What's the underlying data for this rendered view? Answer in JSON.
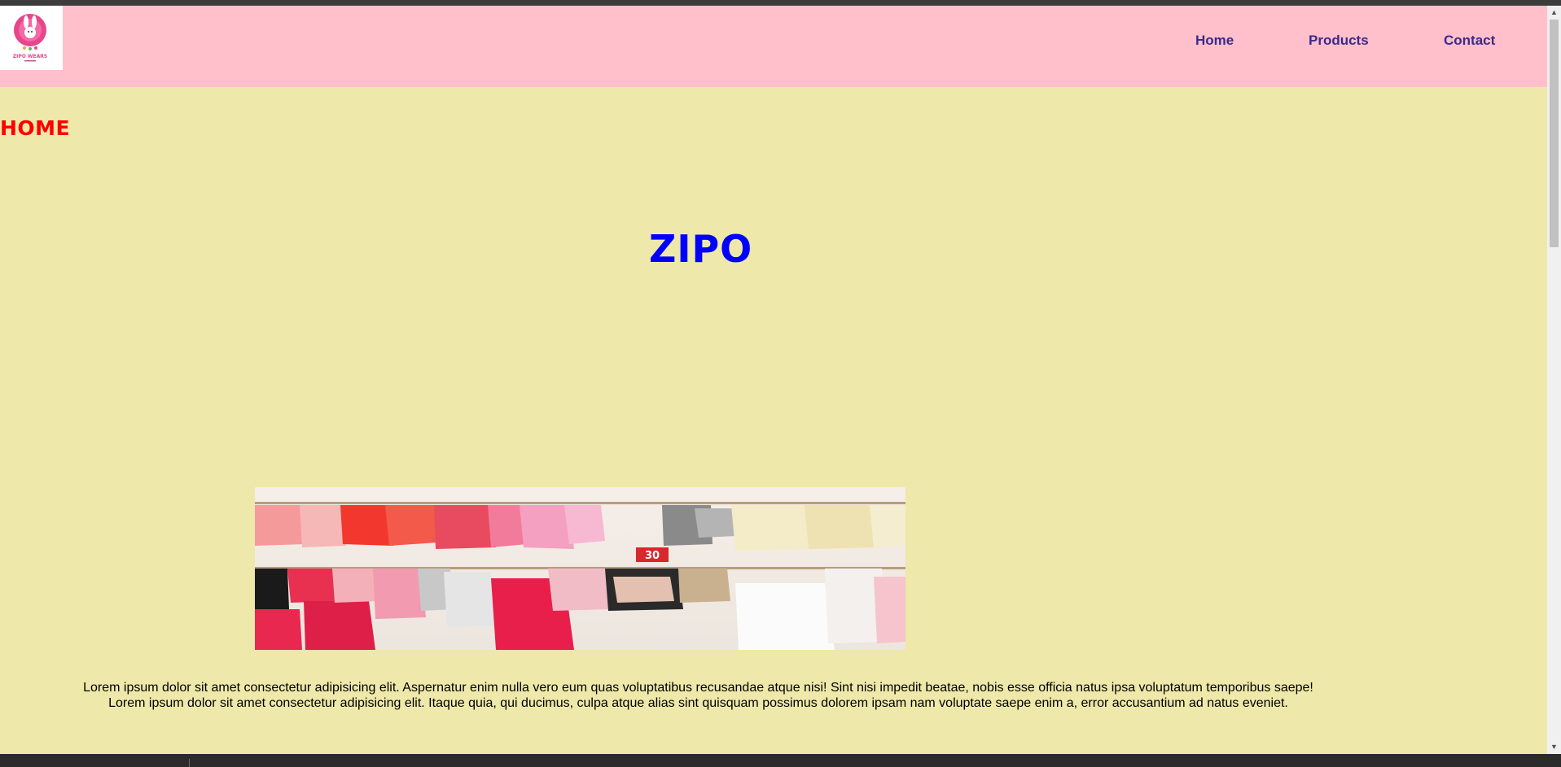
{
  "header": {
    "logo_text": "ZIPO WEARS",
    "nav": {
      "home": "Home",
      "products": "Products",
      "contact": "Contact"
    }
  },
  "main": {
    "section_heading": "HOME",
    "brand_title": "ZIPO",
    "hero_image_badge": "30",
    "paragraph_line1": "Lorem ipsum dolor sit amet consectetur adipisicing elit. Aspernatur enim nulla vero eum quas voluptatibus recusandae atque nisi! Sint nisi impedit beatae, nobis esse officia natus ipsa voluptatum temporibus saepe!",
    "paragraph_line2": "Lorem ipsum dolor sit amet consectetur adipisicing elit. Itaque quia, qui ducimus, culpa atque alias sint quisquam possimus dolorem ipsam nam voluptate saepe enim a, error accusantium ad natus eveniet."
  },
  "colors": {
    "page_background": "#eee8aa",
    "header_background": "#ffc0cb",
    "nav_link": "#3a2a8a",
    "section_heading": "#ff0000",
    "brand_title": "#0000ff"
  },
  "icons": {
    "logo": "zipo-wears-logo-icon",
    "scroll_up": "scroll-up-arrow-icon",
    "scroll_down": "scroll-down-arrow-icon"
  }
}
